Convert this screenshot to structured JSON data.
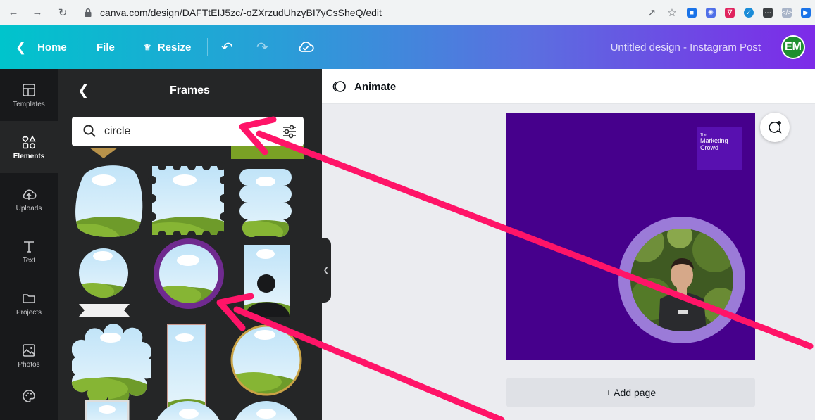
{
  "browser": {
    "url": "canva.com/design/DAFTtEIJ5zc/-oZXrzudUhzyBI7yCsSheQ/edit",
    "back_icon": "arrow-left-icon",
    "forward_icon": "arrow-right-icon",
    "reload_icon": "reload-icon"
  },
  "topbar": {
    "home_label": "Home",
    "file_label": "File",
    "resize_label": "Resize",
    "design_title": "Untitled design - Instagram Post",
    "avatar_initials": "EM"
  },
  "rail": {
    "items": [
      {
        "label": "Templates",
        "icon": "templates-icon"
      },
      {
        "label": "Elements",
        "icon": "elements-icon"
      },
      {
        "label": "Uploads",
        "icon": "upload-cloud-icon"
      },
      {
        "label": "Text",
        "icon": "text-icon"
      },
      {
        "label": "Projects",
        "icon": "folder-icon"
      },
      {
        "label": "Photos",
        "icon": "photo-icon"
      },
      {
        "label": "",
        "icon": "palette-icon"
      }
    ]
  },
  "panel": {
    "title": "Frames",
    "search": {
      "value": "circle"
    }
  },
  "editor": {
    "animate_label": "Animate",
    "add_page_label": "+ Add page",
    "brand_badge": {
      "line1": "The",
      "line2": "Marketing",
      "line3": "Crowd"
    }
  },
  "colors": {
    "canvas_bg": "#46008c",
    "frame_ring": "#9b7bd8",
    "annotation_arrow": "#ff1468",
    "panel_bg": "#252627",
    "rail_bg": "#18191b"
  }
}
